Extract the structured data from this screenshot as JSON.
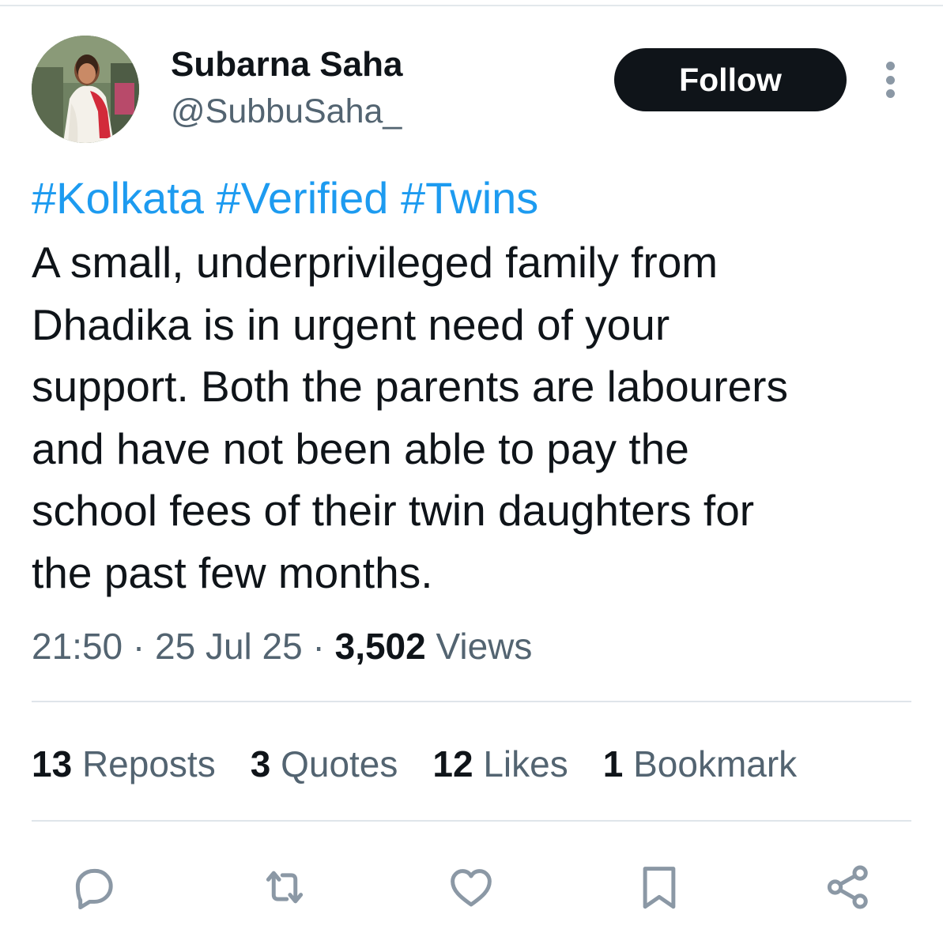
{
  "tweet": {
    "author": {
      "display_name": "Subarna Saha",
      "handle": "@SubbuSaha_"
    },
    "follow_label": "Follow",
    "hashtags": [
      "#Kolkata",
      "#Verified",
      "#Twins"
    ],
    "body_lines": [
      "A small, underprivileged family from",
      "Dhadika is in urgent need of your",
      "support. Both the parents are labourers",
      "and have not been able to pay the",
      "school fees of their twin daughters for",
      "the past few months."
    ],
    "time": "21:50",
    "date": "25 Jul 25",
    "separator": "·",
    "views_count": "3,502",
    "views_label": "Views",
    "stats": [
      {
        "count": "13",
        "label": "Reposts"
      },
      {
        "count": "3",
        "label": "Quotes"
      },
      {
        "count": "12",
        "label": "Likes"
      },
      {
        "count": "1",
        "label": "Bookmark"
      }
    ],
    "actions": [
      "reply-icon",
      "repost-icon",
      "like-icon",
      "bookmark-icon",
      "share-icon"
    ]
  },
  "colors": {
    "link": "#1d9bf0",
    "text": "#0f1419",
    "secondary": "#536471",
    "icon": "#8b98a5",
    "divider": "#dfe5ea",
    "button_bg": "#0f1419"
  }
}
